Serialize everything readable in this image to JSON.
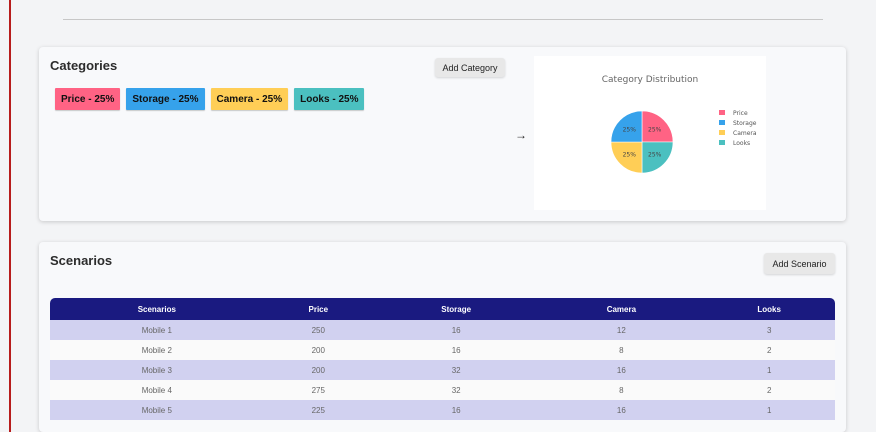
{
  "categories_section": {
    "title": "Categories",
    "add_button": "Add Category",
    "arrow": "→",
    "chips": [
      {
        "label": "Price - 25%",
        "color": "#ff6384"
      },
      {
        "label": "Storage - 25%",
        "color": "#36a2eb"
      },
      {
        "label": "Camera - 25%",
        "color": "#ffce56"
      },
      {
        "label": "Looks - 25%",
        "color": "#4bc0c0"
      }
    ]
  },
  "chart_data": {
    "type": "pie",
    "title": "Category Distribution",
    "labels": [
      "Price",
      "Storage",
      "Camera",
      "Looks"
    ],
    "values": [
      25,
      25,
      25,
      25
    ],
    "data_labels": [
      "25%",
      "25%",
      "25%",
      "25%"
    ],
    "colors": [
      "#ff6384",
      "#36a2eb",
      "#ffce56",
      "#4bc0c0"
    ],
    "legend_position": "right"
  },
  "scenarios_section": {
    "title": "Scenarios",
    "add_button": "Add Scenario",
    "headers": [
      "Scenarios",
      "Price",
      "Storage",
      "Camera",
      "Looks"
    ],
    "rows": [
      [
        "Mobile 1",
        "250",
        "16",
        "12",
        "3"
      ],
      [
        "Mobile 2",
        "200",
        "16",
        "8",
        "2"
      ],
      [
        "Mobile 3",
        "200",
        "32",
        "16",
        "1"
      ],
      [
        "Mobile 4",
        "275",
        "32",
        "8",
        "2"
      ],
      [
        "Mobile 5",
        "225",
        "16",
        "16",
        "1"
      ]
    ]
  }
}
